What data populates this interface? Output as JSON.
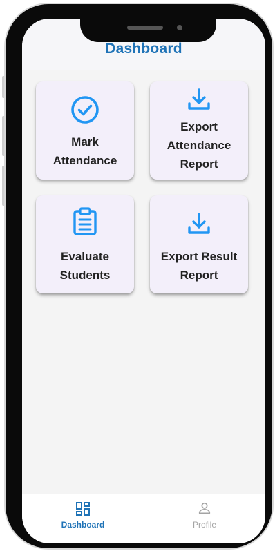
{
  "app_bar": {
    "title": "Dashboard"
  },
  "cards": [
    {
      "label": "Mark\nAttendance",
      "icon": "check-circle-icon"
    },
    {
      "label": "Export\nAttendance\nReport",
      "icon": "download-icon"
    },
    {
      "label": "Evaluate\nStudents",
      "icon": "clipboard-icon"
    },
    {
      "label": "Export Result\nReport",
      "icon": "download-icon"
    }
  ],
  "bottom_nav": {
    "items": [
      {
        "label": "Dashboard",
        "icon": "grid-icon",
        "active": true
      },
      {
        "label": "Profile",
        "icon": "person-icon",
        "active": false
      }
    ]
  },
  "colors": {
    "accent": "#1f73b7",
    "icon_blue": "#2196f3",
    "card_bg": "#f3effa",
    "inactive": "#a4a4a4"
  }
}
